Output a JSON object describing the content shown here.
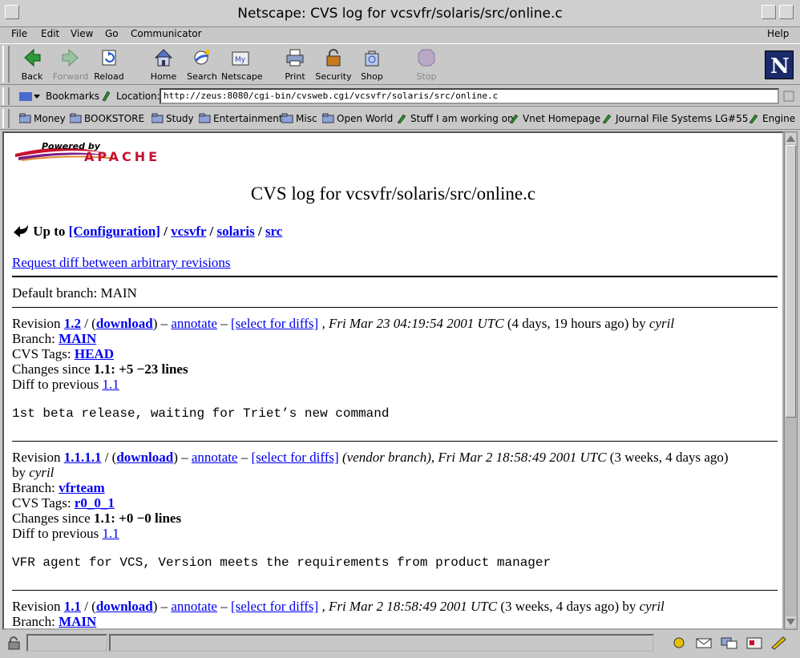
{
  "window": {
    "title": "Netscape: CVS log for vcsvfr/solaris/src/online.c"
  },
  "menu": {
    "file": "File",
    "edit": "Edit",
    "view": "View",
    "go": "Go",
    "communicator": "Communicator",
    "help": "Help"
  },
  "toolbar": {
    "back": "Back",
    "forward": "Forward",
    "reload": "Reload",
    "home": "Home",
    "search": "Search",
    "netscape": "Netscape",
    "print": "Print",
    "security": "Security",
    "shop": "Shop",
    "stop": "Stop"
  },
  "location": {
    "bookmarks": "Bookmarks",
    "label": "Location:",
    "url": "http://zeus:8080/cgi-bin/cvsweb.cgi/vcsvfr/solaris/src/online.c"
  },
  "personal": [
    "Money",
    "BOOKSTORE",
    "Study",
    "Entertainment",
    "Misc",
    "Open World",
    "Stuff I am working on",
    "Vnet Homepage",
    "Journal File Systems LG#55",
    "Engine"
  ],
  "page": {
    "logo_top": "Powered by",
    "logo_bottom": "APACHE",
    "heading": "CVS log for vcsvfr/solaris/src/online.c",
    "up_to": "Up to",
    "crumbs": [
      "[Configuration]",
      "vcsvfr",
      "solaris",
      "src"
    ],
    "sep": "/",
    "request_diff": "Request diff between arbitrary revisions",
    "default_branch": "Default branch: MAIN",
    "revisions": [
      {
        "rev_label": "Revision",
        "rev": "1.2",
        "download": "download",
        "annotate": "annotate",
        "select": "[select for diffs]",
        "pre_date": ",",
        "date": "Fri Mar 23 04:19:54 2001 UTC",
        "age": "(4 days, 19 hours ago) by",
        "author": "cyril",
        "branch_label": "Branch:",
        "branch": "MAIN",
        "tags_label": "CVS Tags:",
        "tags": "HEAD",
        "changes_label": "Changes since",
        "changes_value": "1.1: +5 −23 lines",
        "diff_label": "Diff to previous",
        "diff_rev": "1.1",
        "message": "1st beta release, waiting for Triet’s new command"
      },
      {
        "rev_label": "Revision",
        "rev": "1.1.1.1",
        "download": "download",
        "annotate": "annotate",
        "select": "[select for diffs]",
        "pre_date": "(vendor branch),",
        "date": "Fri Mar 2 18:58:49 2001 UTC",
        "age": "(3 weeks, 4 days ago)",
        "by": "by",
        "author": "cyril",
        "branch_label": "Branch:",
        "branch": "vfrteam",
        "tags_label": "CVS Tags:",
        "tags": "r0_0_1",
        "changes_label": "Changes since",
        "changes_value": "1.1: +0 −0 lines",
        "diff_label": "Diff to previous",
        "diff_rev": "1.1",
        "message": "VFR agent for VCS, Version meets the requirements from product manager"
      },
      {
        "rev_label": "Revision",
        "rev": "1.1",
        "download": "download",
        "annotate": "annotate",
        "select": "[select for diffs]",
        "pre_date": ",",
        "date": "Fri Mar 2 18:58:49 2001 UTC",
        "age": "(3 weeks, 4 days ago) by",
        "author": "cyril",
        "branch_label": "Branch:",
        "branch": "MAIN"
      }
    ]
  },
  "colors": {
    "link": "#0000ee",
    "chrome": "#c8c8c8",
    "apache_red": "#c8102e"
  }
}
